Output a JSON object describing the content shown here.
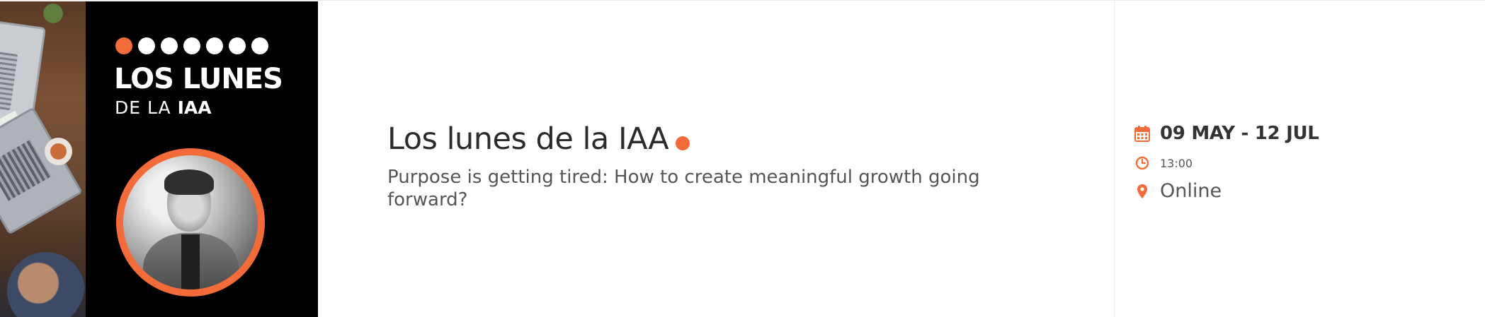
{
  "promo": {
    "title": "LOS LUNES",
    "subtitle_prefix": "DE LA",
    "subtitle_brand": "IAA",
    "dot_count": 7
  },
  "event": {
    "title": "Los lunes de la IAA",
    "description": "Purpose is getting tired: How to create meaningful growth going forward?"
  },
  "meta": {
    "dates": "09 MAY - 12 JUL",
    "time": "13:00",
    "location": "Online",
    "icons": {
      "date": "calendar-icon",
      "time": "clock-icon",
      "location": "map-pin-icon"
    }
  },
  "colors": {
    "accent": "#f26b38",
    "title_text": "#2b2b2b",
    "body_text": "#555555",
    "promo_background": "#000000"
  }
}
